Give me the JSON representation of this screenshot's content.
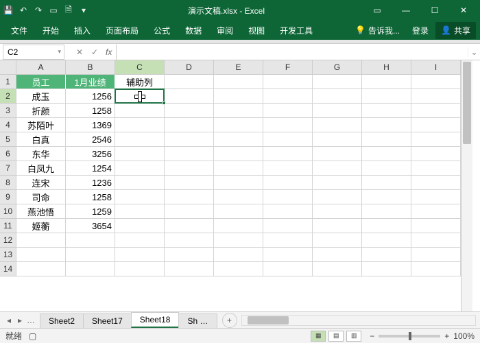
{
  "title": "演示文稿.xlsx - Excel",
  "ribbon": {
    "tabs": [
      "文件",
      "开始",
      "插入",
      "页面布局",
      "公式",
      "数据",
      "审阅",
      "视图",
      "开发工具"
    ],
    "tell": "告诉我...",
    "login": "登录",
    "share": "共享"
  },
  "namebox": "C2",
  "columns": [
    "A",
    "B",
    "C",
    "D",
    "E",
    "F",
    "G",
    "H",
    "I"
  ],
  "headers": {
    "A": "员工",
    "B": "1月业绩",
    "C": "辅助列"
  },
  "rows": [
    {
      "A": "成玉",
      "B": "1256"
    },
    {
      "A": "折颜",
      "B": "1258"
    },
    {
      "A": "苏陌叶",
      "B": "1369"
    },
    {
      "A": "白真",
      "B": "2546"
    },
    {
      "A": "东华",
      "B": "3256"
    },
    {
      "A": "白凤九",
      "B": "1254"
    },
    {
      "A": "连宋",
      "B": "1236"
    },
    {
      "A": "司命",
      "B": "1258"
    },
    {
      "A": "燕池悟",
      "B": "1259"
    },
    {
      "A": "姬蘅",
      "B": "3654"
    }
  ],
  "sheets": [
    "Sheet2",
    "Sheet17",
    "Sheet18",
    "Sh …"
  ],
  "activeSheet": "Sheet18",
  "status": "就绪",
  "zoom": "100%",
  "activeCell": {
    "col": 2,
    "row": 2
  }
}
